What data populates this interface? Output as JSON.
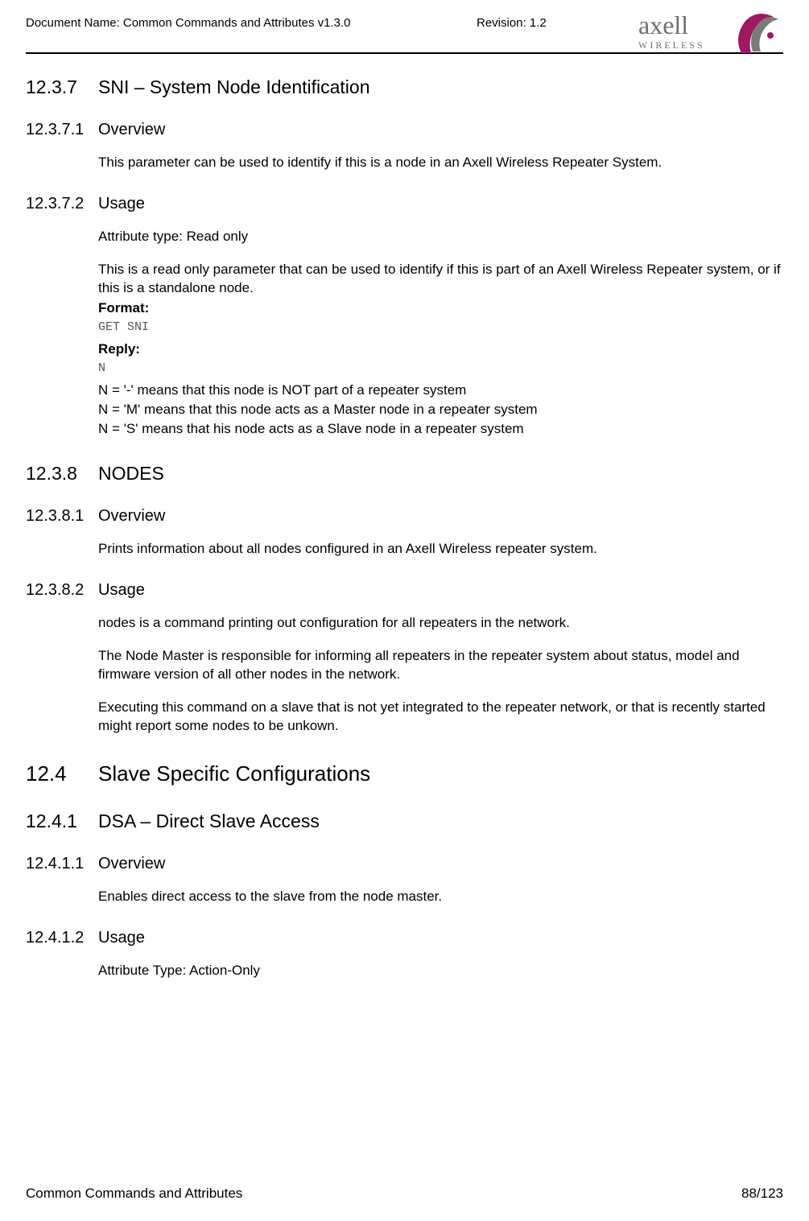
{
  "header": {
    "document_name_label": "Document Name: Common Commands and Attributes v1.3.0",
    "revision_label": "Revision: 1.2",
    "logo_main": "axell",
    "logo_sub": "WIRELESS"
  },
  "sections": [
    {
      "num": "12.3.7",
      "title": "SNI – System Node Identification",
      "level": "h3",
      "first": true,
      "subsections": [
        {
          "num": "12.3.7.1",
          "title": "Overview",
          "level": "h4",
          "body": [
            {
              "type": "p",
              "text": "This parameter can be used to identify if this is a node in an Axell Wireless Repeater System."
            }
          ]
        },
        {
          "num": "12.3.7.2",
          "title": "Usage",
          "level": "h4",
          "body": [
            {
              "type": "p",
              "text": "Attribute type: Read only"
            },
            {
              "type": "p_tight",
              "text": "This is a read only parameter that can be used to identify if this is part of an Axell Wireless Repeater system, or if this is a standalone node."
            },
            {
              "type": "bold_tight",
              "text": "Format:"
            },
            {
              "type": "mono",
              "text": "GET SNI"
            },
            {
              "type": "bold_tight",
              "text": "Reply:"
            },
            {
              "type": "mono",
              "text": "N"
            },
            {
              "type": "rules",
              "lines": [
                "N = '-' means that this node is NOT part of a repeater system",
                "N = 'M' means that this node acts as a Master node in a repeater system",
                "N = 'S' means that his node acts as a Slave node in a repeater system"
              ]
            }
          ]
        }
      ]
    },
    {
      "num": "12.3.8",
      "title": "NODES",
      "level": "h3",
      "subsections": [
        {
          "num": "12.3.8.1",
          "title": "Overview",
          "level": "h4",
          "body": [
            {
              "type": "p",
              "text": "Prints information about all nodes configured in an Axell Wireless repeater system."
            }
          ]
        },
        {
          "num": "12.3.8.2",
          "title": "Usage",
          "level": "h4",
          "body": [
            {
              "type": "p",
              "text": "nodes is a command printing out configuration for all repeaters in the network."
            },
            {
              "type": "p",
              "text": "The Node Master is responsible for informing all repeaters in the repeater system about status, model and firmware version of all other nodes in the network."
            },
            {
              "type": "p",
              "text": "Executing this command on a slave that is not yet integrated to the repeater network, or that is recently started might report some nodes to be unkown."
            }
          ]
        }
      ]
    },
    {
      "num": "12.4",
      "title": "Slave Specific Configurations",
      "level": "h2",
      "subsections": [
        {
          "num": "12.4.1",
          "title": "DSA – Direct Slave Access",
          "level": "h3",
          "subsections": [
            {
              "num": "12.4.1.1",
              "title": "Overview",
              "level": "h4",
              "body": [
                {
                  "type": "p",
                  "text": "Enables direct access to the slave from the node master."
                }
              ]
            },
            {
              "num": "12.4.1.2",
              "title": "Usage",
              "level": "h4",
              "body": [
                {
                  "type": "p",
                  "text": "Attribute Type: Action-Only"
                }
              ]
            }
          ]
        }
      ]
    }
  ],
  "footer": {
    "left": "Common Commands and Attributes",
    "right": "88/123"
  }
}
